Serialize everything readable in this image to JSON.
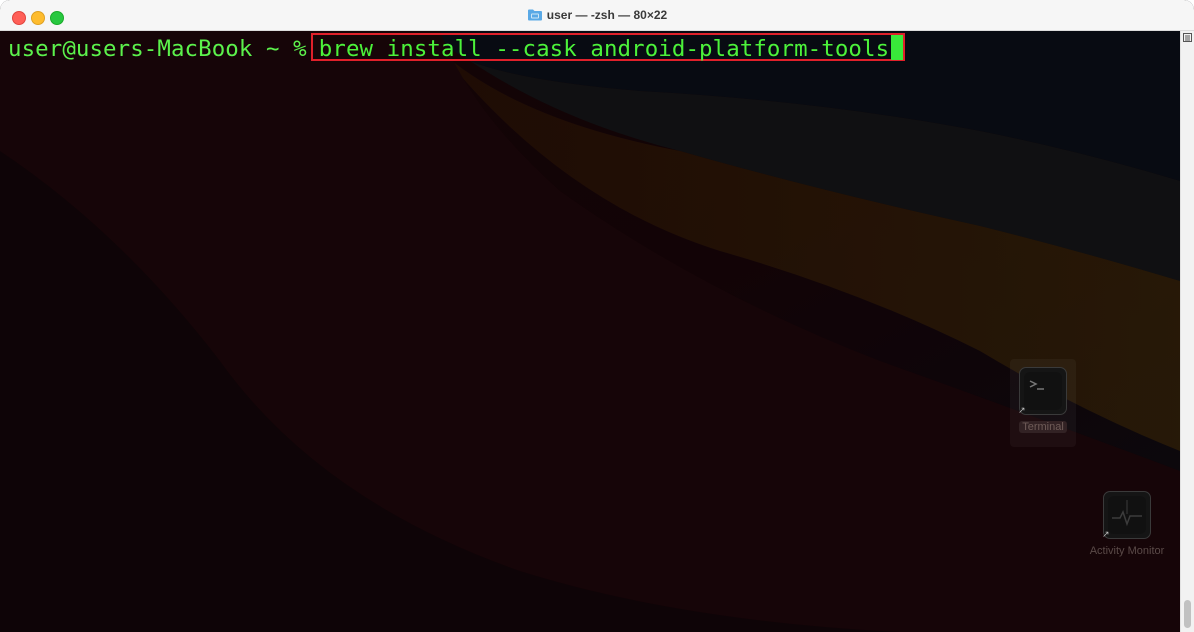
{
  "window": {
    "title": "user — -zsh — 80×22",
    "title_icon": "folder-icon"
  },
  "terminal": {
    "prompt": "user@users-MacBook ~ %",
    "command": "brew install --cask android-platform-tools",
    "text_color": "#4cf23a",
    "highlight_color": "#e0202a"
  },
  "desktop": {
    "icons": [
      {
        "label": "Terminal",
        "icon": "terminal-app-icon"
      },
      {
        "label": "Activity Monitor",
        "icon": "activity-monitor-app-icon"
      }
    ]
  },
  "colors": {
    "close": "#ff5f57",
    "minimize": "#febc2e",
    "maximize": "#28c840"
  }
}
